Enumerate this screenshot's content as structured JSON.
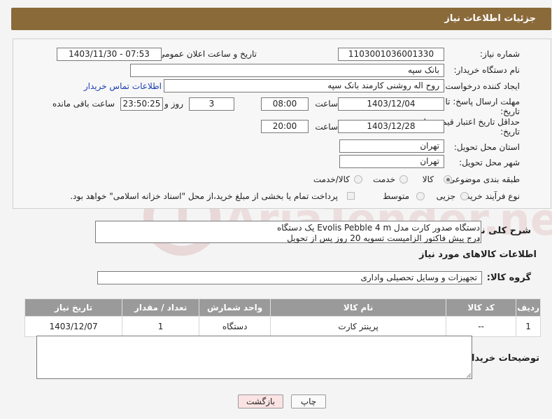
{
  "header": {
    "title": "جزئیات اطلاعات نیاز"
  },
  "form": {
    "need_number_label": "شماره نیاز:",
    "need_number": "1103001036001330",
    "announce_label": "تاریخ و ساعت اعلان عمومی:",
    "announce_value": "1403/11/30 - 07:53",
    "buyer_org_label": "نام دستگاه خریدار:",
    "buyer_org": "بانک سپه",
    "requester_label": "ایجاد کننده درخواست:",
    "requester": "روح اله روشنی کارمند بانک سپه",
    "contact_link": "اطلاعات تماس خریدار",
    "reply_deadline_label_1": "مهلت ارسال پاسخ: تا",
    "reply_deadline_label_2": "تاریخ:",
    "reply_date": "1403/12/04",
    "time_label": "ساعت",
    "reply_time": "08:00",
    "days_value": "3",
    "days_label": "روز و",
    "remaining_value": "23:50:25",
    "remaining_label": "ساعت باقی مانده",
    "validity_label_1": "حداقل تاریخ اعتبار قیمت: تا",
    "validity_label_2": "تاریخ:",
    "validity_date": "1403/12/28",
    "validity_time": "20:00",
    "province_label": "استان محل تحویل:",
    "province": "تهران",
    "city_label": "شهر محل تحویل:",
    "city": "تهران",
    "category_label": "طبقه بندی موضوعی:",
    "category_options": [
      "کالا",
      "خدمت",
      "کالا/خدمت"
    ],
    "process_label": "نوع فرآیند خرید :",
    "process_options": [
      "جزیی",
      "متوسط"
    ],
    "payment_note": "پرداخت تمام یا بخشی از مبلغ خرید،از محل \"اسناد خزانه اسلامی\" خواهد بود."
  },
  "description": {
    "label": "شرح کلی نیاز:",
    "line1": "دستگاه صدور کارت مدل Evolis Pebble 4 m یک دستگاه",
    "line2": "درج پیش فاکتور الزامیست تسویه 20 روز پس از تحویل"
  },
  "goods": {
    "section_title": "اطلاعات کالاهای مورد نیاز",
    "group_label": "گروه کالا:",
    "group_value": "تجهیزات و وسایل تحصیلی واداری",
    "table": {
      "headers": [
        "ردیف",
        "کد کالا",
        "نام کالا",
        "واحد شمارش",
        "تعداد / مقدار",
        "تاریخ نیاز"
      ],
      "rows": [
        [
          "1",
          "--",
          "پرینتر کارت",
          "دستگاه",
          "1",
          "1403/12/07"
        ]
      ]
    }
  },
  "buyer_notes": {
    "label": "توضیحات خریدار:"
  },
  "buttons": {
    "print": "چاپ",
    "back": "بازگشت"
  },
  "watermark": {
    "text": "AriaTender.neT"
  }
}
